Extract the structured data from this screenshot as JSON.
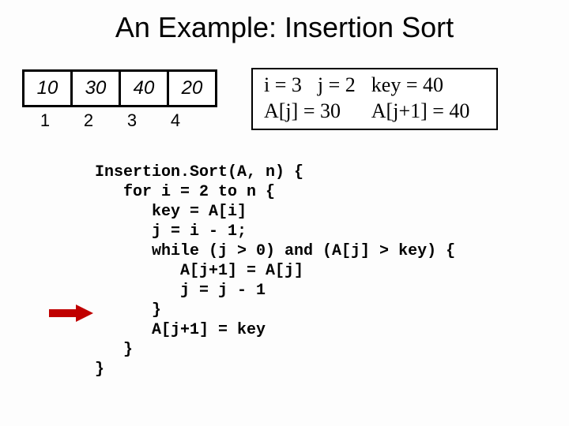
{
  "title": "An Example: Insertion Sort",
  "array": {
    "values": [
      "10",
      "30",
      "40",
      "20"
    ],
    "indices": [
      "1",
      "2",
      "3",
      "4"
    ]
  },
  "state": {
    "i": "i = 3",
    "j": "j = 2",
    "key": "key = 40",
    "aj": "A[j] = 30",
    "aj1": "A[j+1] = 40"
  },
  "code": {
    "l1": "Insertion.Sort(A, n) {",
    "l2": "   for i = 2 to n {",
    "l3": "      key = A[i]",
    "l4": "      j = i - 1;",
    "l5": "      while (j > 0) and (A[j] > key) {",
    "l6": "         A[j+1] = A[j]",
    "l7": "         j = j - 1",
    "l8": "      }",
    "l9": "      A[j+1] = key",
    "l10": "   }",
    "l11": "}"
  },
  "arrow_label": "current-line-pointer"
}
